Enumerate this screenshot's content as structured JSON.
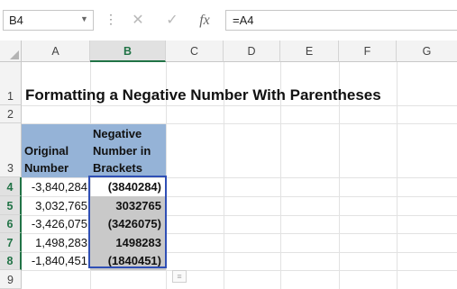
{
  "formula_bar": {
    "name_box": "B4",
    "cancel_icon": "✕",
    "enter_icon": "✓",
    "function_icon": "fx",
    "formula": "=A4"
  },
  "columns": [
    "A",
    "B",
    "C",
    "D",
    "E",
    "F",
    "G"
  ],
  "rows": [
    "1",
    "2",
    "3",
    "4",
    "5",
    "6",
    "7",
    "8",
    "9"
  ],
  "title": "Formatting a Negative Number With Parentheses",
  "headers": {
    "a_line1": "Original",
    "a_line2": "Number",
    "b_line1": "Negative",
    "b_line2": "Number in",
    "b_line3": "Brackets"
  },
  "data": [
    {
      "a": "-3,840,284",
      "b": "(3840284)"
    },
    {
      "a": "3,032,765",
      "b": "3032765"
    },
    {
      "a": "-3,426,075",
      "b": "(3426075)"
    },
    {
      "a": "1,498,283",
      "b": "1498283"
    },
    {
      "a": "-1,840,451",
      "b": "(1840451)"
    }
  ],
  "colors": {
    "header_fill": "#95b3d7",
    "selection_border": "#2f4fb5",
    "selected_header": "#217346",
    "cell_gray": "#c9c9c9"
  }
}
